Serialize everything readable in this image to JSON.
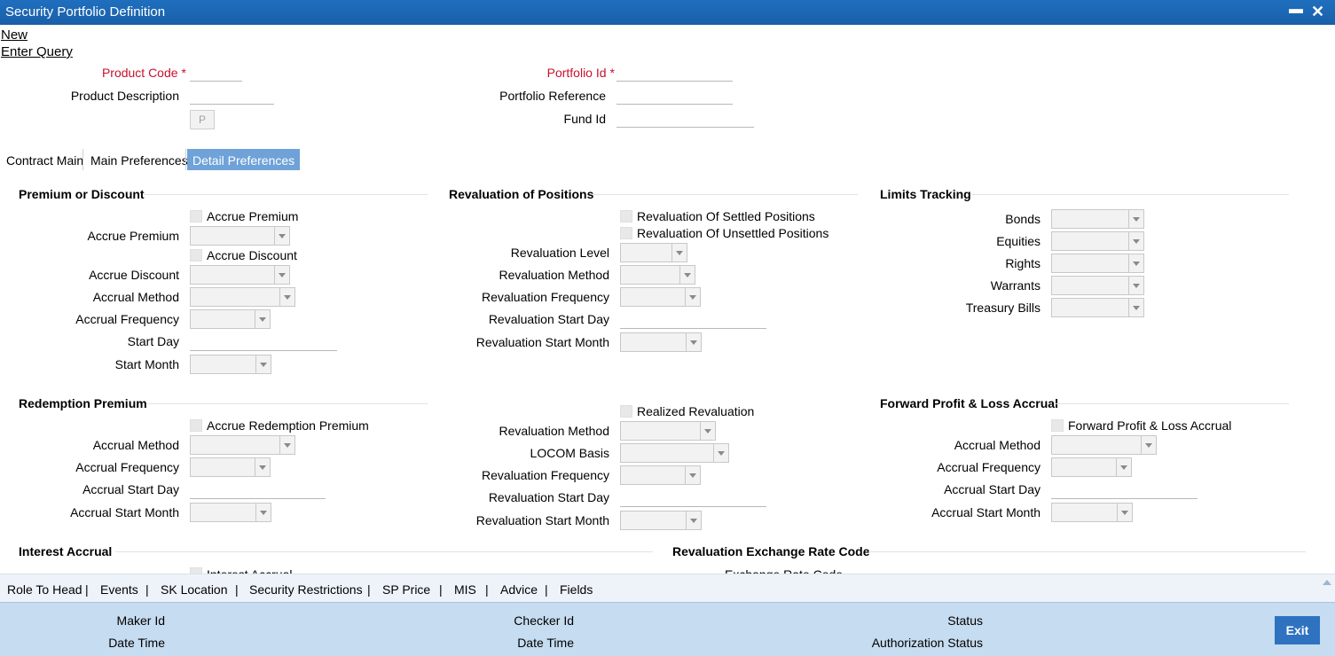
{
  "window": {
    "title": "Security Portfolio Definition",
    "minimize_label": "▬",
    "close_label": "✕"
  },
  "actions": {
    "new": "New",
    "enter_query": "Enter Query"
  },
  "header": {
    "product_code_label": "Product Code",
    "required_mark": "*",
    "product_code_value": "",
    "product_description_label": "Product Description",
    "product_description_value": "",
    "p_button": "P",
    "portfolio_id_label": "Portfolio Id",
    "portfolio_id_value": "",
    "portfolio_reference_label": "Portfolio Reference",
    "portfolio_reference_value": "",
    "fund_id_label": "Fund Id",
    "fund_id_value": ""
  },
  "tabs": [
    {
      "label": "Contract Main",
      "active": false
    },
    {
      "label": "Main Preferences",
      "active": false
    },
    {
      "label": "Detail Preferences",
      "active": true
    }
  ],
  "premium_discount": {
    "title": "Premium or Discount",
    "accrue_premium_check": "Accrue Premium",
    "accrue_premium_label": "Accrue Premium",
    "accrue_discount_check": "Accrue Discount",
    "accrue_discount_label": "Accrue Discount",
    "accrual_method_label": "Accrual Method",
    "accrual_frequency_label": "Accrual Frequency",
    "start_day_label": "Start Day",
    "start_month_label": "Start Month"
  },
  "revaluation_positions": {
    "title": "Revaluation of Positions",
    "settled_check": "Revaluation Of Settled Positions",
    "unsettled_check": "Revaluation Of Unsettled Positions",
    "level_label": "Revaluation Level",
    "method_label": "Revaluation Method",
    "frequency_label": "Revaluation Frequency",
    "start_day_label": "Revaluation Start Day",
    "start_month_label": "Revaluation Start Month"
  },
  "limits_tracking": {
    "title": "Limits Tracking",
    "bonds_label": "Bonds",
    "equities_label": "Equities",
    "rights_label": "Rights",
    "warrants_label": "Warrants",
    "treasury_bills_label": "Treasury Bills"
  },
  "redemption_premium": {
    "title": "Redemption Premium",
    "accrue_check": "Accrue Redemption Premium",
    "accrual_method_label": "Accrual Method",
    "accrual_frequency_label": "Accrual Frequency",
    "accrual_start_day_label": "Accrual Start Day",
    "accrual_start_month_label": "Accrual Start Month"
  },
  "realized_revaluation": {
    "check": "Realized Revaluation",
    "method_label": "Revaluation Method",
    "locom_label": "LOCOM Basis",
    "frequency_label": "Revaluation Frequency",
    "start_day_label": "Revaluation Start Day",
    "start_month_label": "Revaluation Start Month"
  },
  "forward_pl": {
    "title": "Forward Profit & Loss Accrual",
    "check": "Forward Profit & Loss Accrual",
    "accrual_method_label": "Accrual Method",
    "accrual_frequency_label": "Accrual Frequency",
    "accrual_start_day_label": "Accrual Start Day",
    "accrual_start_month_label": "Accrual Start Month"
  },
  "interest_accrual": {
    "title": "Interest Accrual",
    "check": "Interest Accrual"
  },
  "revaluation_exchange": {
    "title": "Revaluation Exchange Rate Code",
    "rate_code_label": "Exchange Rate Code"
  },
  "bottom_nav": {
    "items": [
      "Role To Head",
      "Events",
      "SK Location",
      "Security Restrictions",
      "SP Price",
      "MIS",
      "Advice",
      "Fields"
    ],
    "separator": "|"
  },
  "footer": {
    "maker_id_label": "Maker Id",
    "date_time_label": "Date Time",
    "checker_id_label": "Checker Id",
    "checker_date_time_label": "Date Time",
    "status_label": "Status",
    "authorization_status_label": "Authorization Status",
    "exit_button": "Exit"
  }
}
